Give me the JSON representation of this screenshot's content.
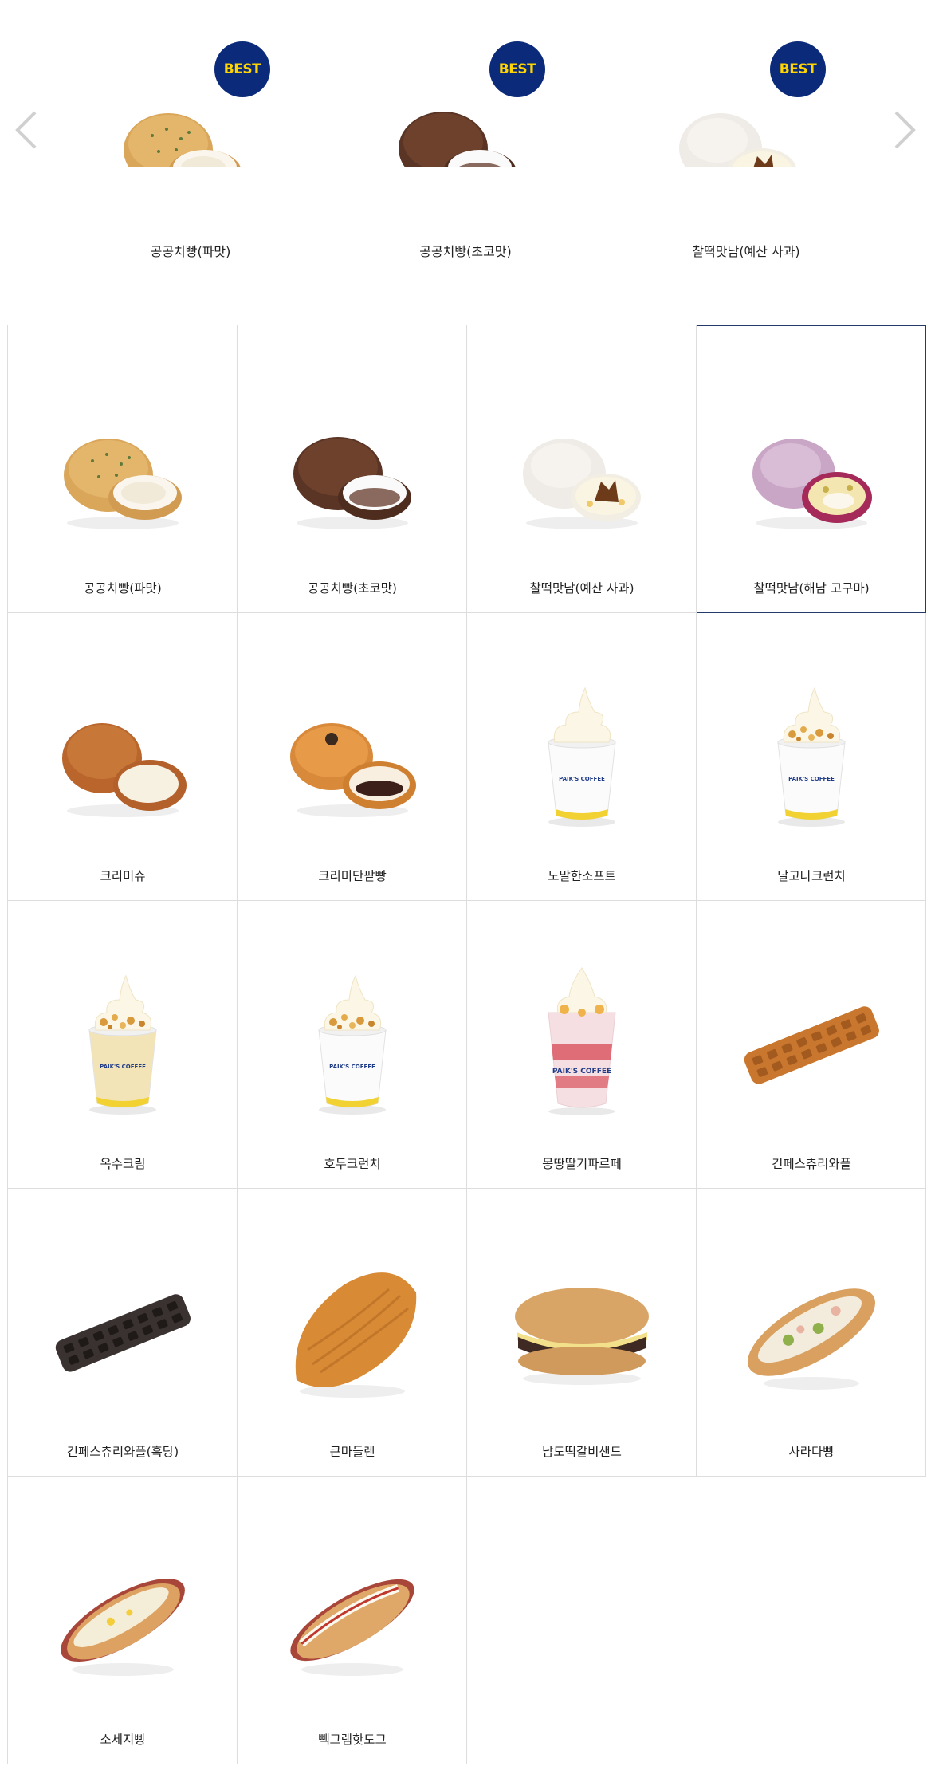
{
  "carousel": {
    "prev_icon": "chevron-left-icon",
    "next_icon": "chevron-right-icon",
    "badge_label": "BEST",
    "badge_color": "#0b2a7a",
    "badge_text_color": "#ffd400",
    "items": [
      {
        "name": "공공치빵(파맛)",
        "image": "green-onion-bun"
      },
      {
        "name": "공공치빵(초코맛)",
        "image": "chocolate-bun"
      },
      {
        "name": "찰떡맛남(예산 사과)",
        "image": "apple-rice-cake"
      }
    ]
  },
  "grid": {
    "items": [
      {
        "name": "공공치빵(파맛)",
        "image": "green-onion-bun"
      },
      {
        "name": "공공치빵(초코맛)",
        "image": "chocolate-bun"
      },
      {
        "name": "찰떡맛남(예산 사과)",
        "image": "apple-rice-cake"
      },
      {
        "name": "찰떡맛남(해남 고구마)",
        "image": "sweet-potato-rice-cake",
        "selected": true
      },
      {
        "name": "크리미슈",
        "image": "cream-puff"
      },
      {
        "name": "크리미단팥빵",
        "image": "red-bean-bun"
      },
      {
        "name": "노말한소프트",
        "image": "soft-serve-cup"
      },
      {
        "name": "달고나크런치",
        "image": "dalgona-soft-serve-cup"
      },
      {
        "name": "옥수크림",
        "image": "corn-cream-cup"
      },
      {
        "name": "호두크런치",
        "image": "walnut-soft-serve-cup"
      },
      {
        "name": "몽땅딸기파르페",
        "image": "strawberry-parfait"
      },
      {
        "name": "긴페스츄리와플",
        "image": "long-waffle"
      },
      {
        "name": "긴페스츄리와플(흑당)",
        "image": "dark-long-waffle"
      },
      {
        "name": "큰마들렌",
        "image": "madeleine"
      },
      {
        "name": "남도떡갈비샌드",
        "image": "galbi-sandwich"
      },
      {
        "name": "사라다빵",
        "image": "salad-bun"
      },
      {
        "name": "소세지빵",
        "image": "sausage-bread"
      },
      {
        "name": "빽그램핫도그",
        "image": "hotdog"
      }
    ]
  },
  "colors": {
    "border": "#dddddd",
    "selected_border": "#233a6b",
    "arrow": "#d0d0d0"
  },
  "cup_brand": "PAIK'S COFFEE"
}
